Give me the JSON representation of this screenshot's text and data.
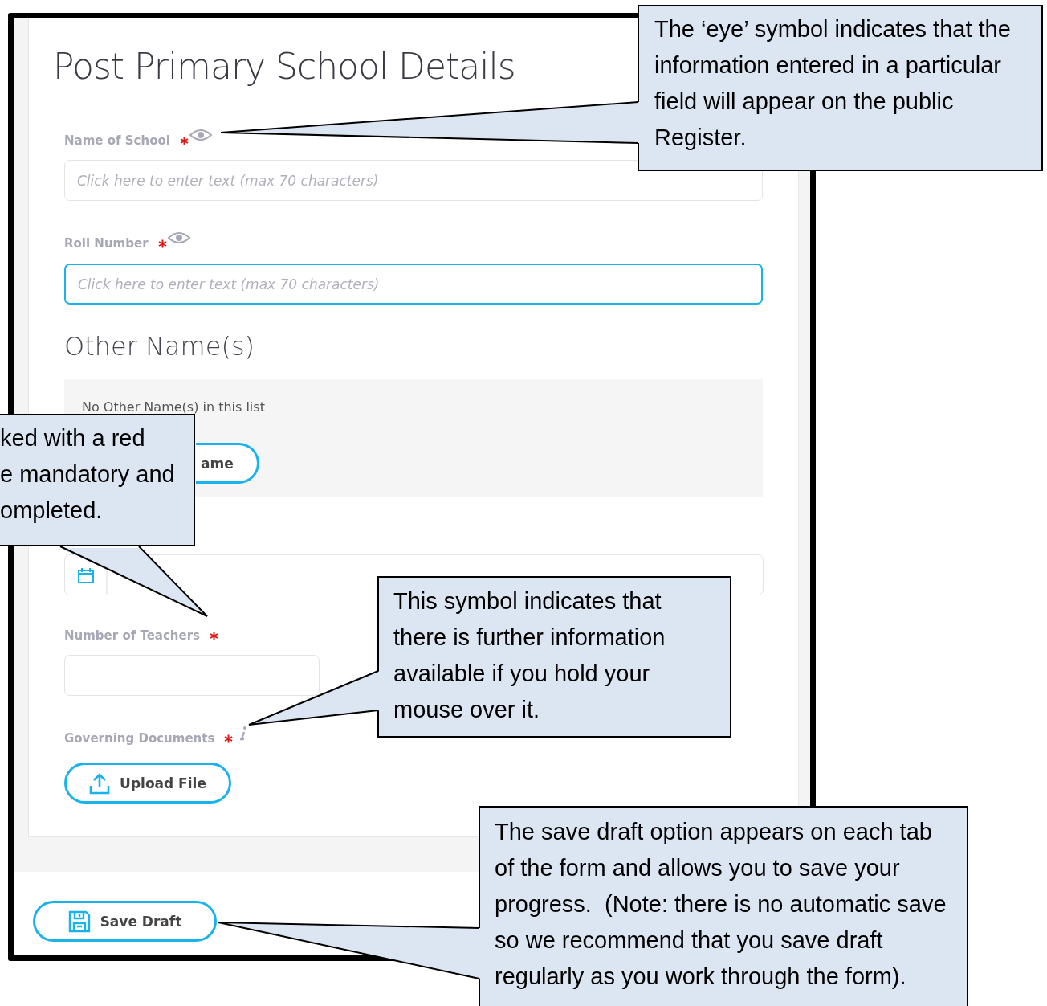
{
  "form": {
    "title": "Post Primary School Details",
    "items": [
      {
        "kind": "text",
        "label": "Name of School",
        "required": true,
        "public": true,
        "placeholder": "Click here to enter text (max 70 characters)",
        "focused": false
      },
      {
        "kind": "text",
        "label": "Roll Number",
        "required": true,
        "public": true,
        "placeholder": "Click here to enter text (max 70 characters)",
        "focused": true
      },
      {
        "kind": "list",
        "heading": "Other Name(s)",
        "empty_text": "No Other Name(s) in this list",
        "button": "ame"
      },
      {
        "kind": "date"
      },
      {
        "kind": "text",
        "label": "Number of Teachers",
        "required": true,
        "public": false,
        "focused": false
      },
      {
        "kind": "upload",
        "label": "Governing Documents",
        "required": true,
        "info": true,
        "button": "Upload File"
      }
    ]
  },
  "save_button": "Save Draft",
  "callouts": [
    {
      "lines": [
        "The ‘eye’ symbol indicates that the",
        "information entered in a particular",
        "field will appear on the public",
        "Register."
      ]
    },
    {
      "lines": [
        "ked with a red",
        "e mandatory and",
        "ompleted."
      ]
    },
    {
      "lines": [
        "This symbol indicates that",
        "there is further information",
        "available if you hold your",
        "mouse over it."
      ]
    },
    {
      "lines": [
        "The save draft option appears on each tab",
        "of the form and allows you to save your",
        "progress.  (Note: there is no automatic save",
        "so we recommend that you save draft",
        "regularly as you work through the form)."
      ]
    }
  ]
}
